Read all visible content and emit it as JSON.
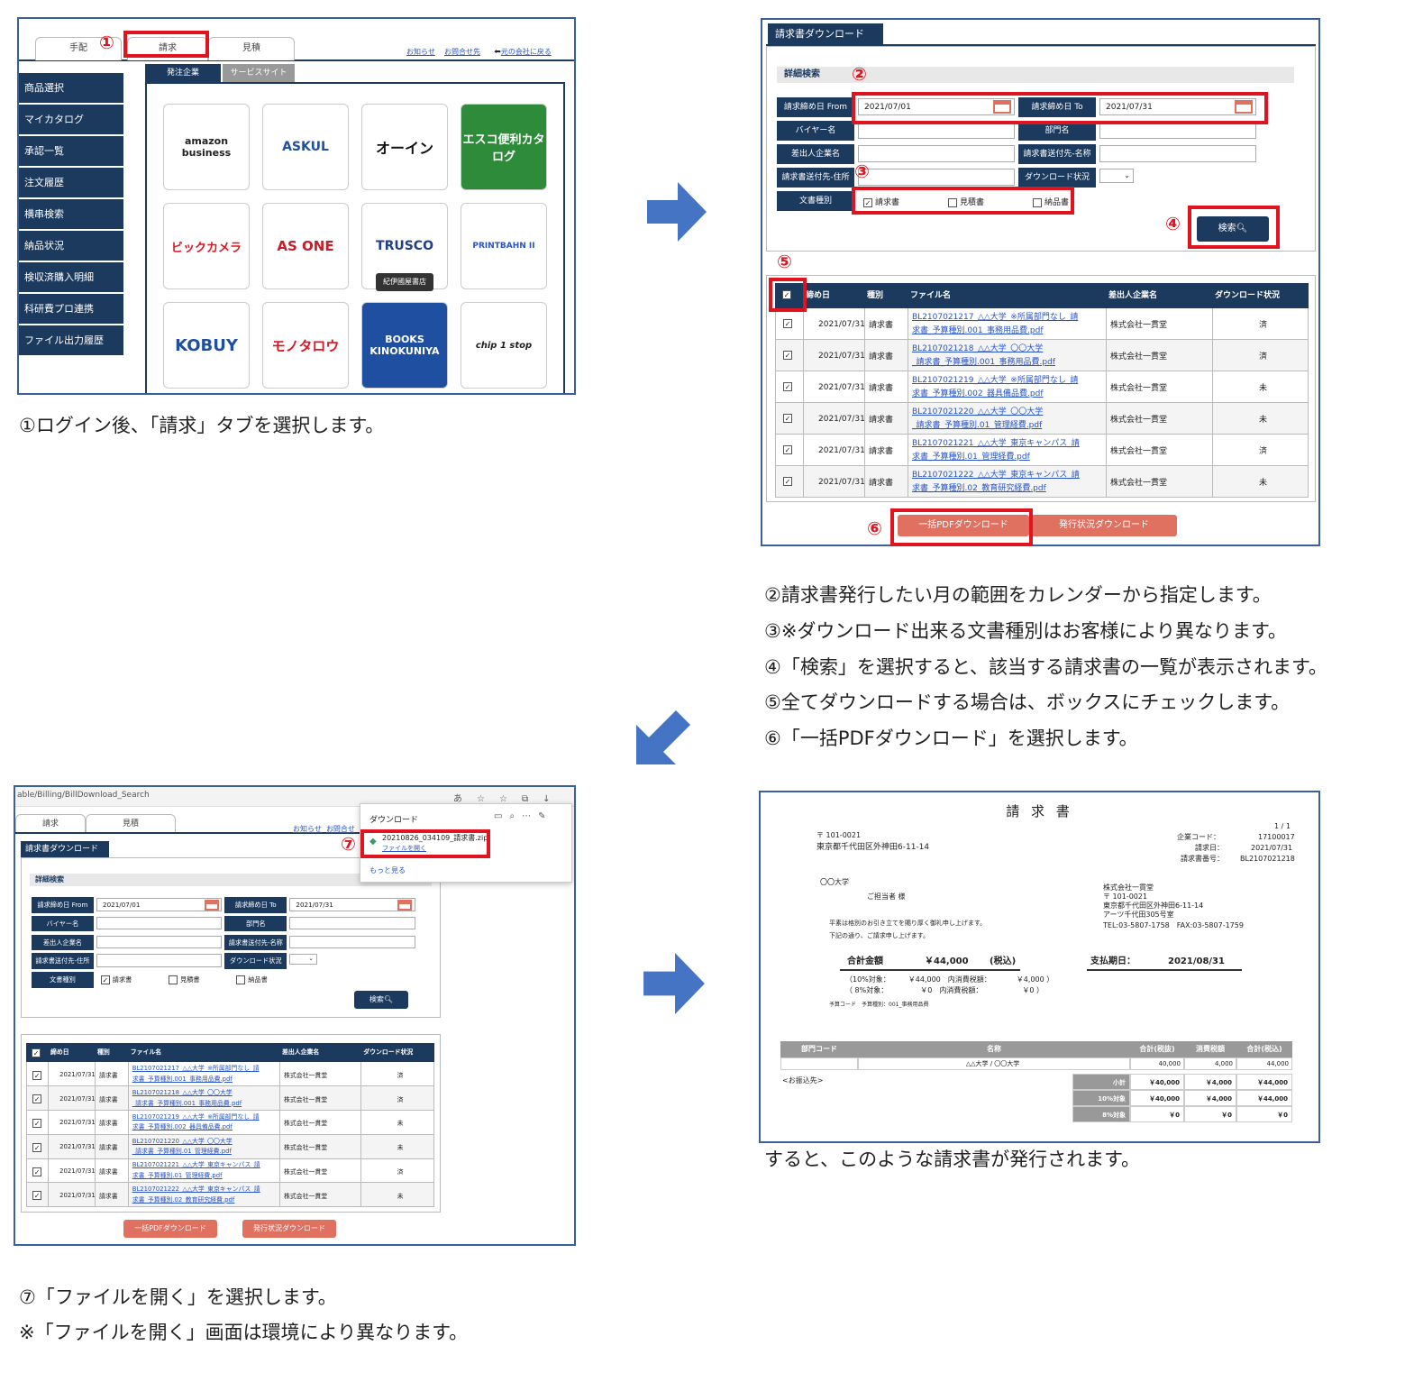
{
  "p1": {
    "tabs": [
      "手配",
      "請求",
      "見積"
    ],
    "links": [
      "お知らせ",
      "お問合せ先",
      "元の会社に戻る"
    ],
    "subtabs": [
      "発注企業",
      "サービスサイト"
    ],
    "sidebar": [
      "商品選択",
      "マイカタログ",
      "承認一覧",
      "注文履歴",
      "横串検索",
      "納品状況",
      "検収済購入明細",
      "科研費プロ連携",
      "ファイル出力履歴"
    ],
    "logos": [
      "amazon business",
      "ASKUL",
      "オーイン",
      "エスコ便利カタログ",
      "ビックカメラ",
      "AS ONE",
      "TRUSCO",
      "PRINTBAHN II",
      "KOBUY",
      "モノタロウ",
      "BOOKS KINOKUNIYA",
      "chip 1 stop"
    ],
    "tooltip": "紀伊國屋書店",
    "caption": "①ログイン後、「請求」タブを選択します。"
  },
  "p2": {
    "title": "請求書ダウンロード",
    "section": "詳細検索",
    "labels": [
      "請求締め日 From",
      "請求締め日 To",
      "バイヤー名",
      "部門名",
      "差出人企業名",
      "請求書送付先-名称",
      "請求書送付先-住所",
      "ダウンロード状況",
      "文書種別"
    ],
    "from": "2021/07/01",
    "to": "2021/07/31",
    "doc_types": [
      "請求書",
      "見積書",
      "納品書"
    ],
    "search_btn": "検索",
    "headers": [
      "締め日",
      "種別",
      "ファイル名",
      "差出人企業名",
      "ダウンロード状況"
    ],
    "rows": [
      {
        "date": "2021/07/31",
        "type": "請求書",
        "file1": "BL2107021217_△△大学_※所属部門なし_請",
        "file2": "求書_予算種別.001_事務用品費.pdf",
        "sender": "株式会社一貫堂",
        "status": "済"
      },
      {
        "date": "2021/07/31",
        "type": "請求書",
        "file1": "BL2107021218_△△大学_〇〇大学",
        "file2": "_請求書_予算種別.001_事務用品費.pdf",
        "sender": "株式会社一貫堂",
        "status": "済"
      },
      {
        "date": "2021/07/31",
        "type": "請求書",
        "file1": "BL2107021219_△△大学_※所属部門なし_請",
        "file2": "求書_予算種別.002_器具備品費.pdf",
        "sender": "株式会社一貫堂",
        "status": "未"
      },
      {
        "date": "2021/07/31",
        "type": "請求書",
        "file1": "BL2107021220_△△大学_〇〇大学",
        "file2": "_請求書_予算種別.01_管理経費.pdf",
        "sender": "株式会社一貫堂",
        "status": "未"
      },
      {
        "date": "2021/07/31",
        "type": "請求書",
        "file1": "BL2107021221_△△大学_東京キャンパス_請",
        "file2": "求書_予算種別.01_管理経費.pdf",
        "sender": "株式会社一貫堂",
        "status": "済"
      },
      {
        "date": "2021/07/31",
        "type": "請求書",
        "file1": "BL2107021222_△△大学_東京キャンパス_請",
        "file2": "求書_予算種別.02_教育研究経費.pdf",
        "sender": "株式会社一貫堂",
        "status": "未"
      }
    ],
    "btn_bulk": "一括PDFダウンロード",
    "btn_status": "発行状況ダウンロード",
    "captions": [
      "②請求書発行したい月の範囲をカレンダーから指定します。",
      "③※ダウンロード出来る文書種別はお客様により異なります。",
      "④「検索」を選択すると、該当する請求書の一覧が表示されます。",
      "⑤全てダウンロードする場合は、ボックスにチェックします。",
      "⑥「一括PDFダウンロード」を選択します。"
    ]
  },
  "p3": {
    "url": "able/Billing/BillDownload_Search",
    "addr_icons": [
      "あ",
      "☆",
      "☆",
      "⧉",
      "↓"
    ],
    "tabs": [
      "請求",
      "見積"
    ],
    "links": [
      "お知らせ",
      "お問合せ"
    ],
    "dl_title": "ダウンロード",
    "dl_file": "20210826_034109_請求書.zip",
    "dl_open": "ファイルを開く",
    "dl_more": "もっと見る",
    "captions": [
      "⑦「ファイルを開く」を選択します。",
      "※「ファイルを開く」画面は環境により異なります。"
    ]
  },
  "p4": {
    "title": "請 求 書",
    "page": "1 / 1",
    "zip": "〒 101-0021",
    "addr": "東京都千代田区外神田6-11-14",
    "company_code_l": "企業コード：",
    "company_code": "17100017",
    "date_l": "請求日：",
    "date": "2021/07/31",
    "no_l": "請求書番号：",
    "no": "BL2107021218",
    "to": "〇〇大学",
    "to_person": "ご担当者 様",
    "from_name": "株式会社一貫堂",
    "from_zip": "〒 101-0021",
    "from_addr": "東京都千代田区外神田6-11-14",
    "from_bldg": "アーツ千代田305号室",
    "from_tel": "TEL:03-5807-1758　FAX:03-5807-1759",
    "greet1": "平素は格別のお引き立てを賜り厚く御礼申し上げます。",
    "greet2": "下記の通り、ご請求申し上げます。",
    "total_l": "合計金額",
    "total": "￥44,000",
    "tax_in": "(税込)",
    "due_l": "支払期日：",
    "due": "2021/08/31",
    "t10": "（10%対象：　　　￥44,000　内消費税額：　　　　￥4,000 ）",
    "t8": "（ 8%対象：　　　　　￥0　内消費税額：　　　　　　￥0 ）",
    "budget": "予算コード　予算種別：001_事務用品費",
    "headers": [
      "部門コード",
      "名称",
      "合計(税抜)",
      "消費税額",
      "合計(税込)"
    ],
    "line": [
      "",
      "△△大学 / 〇〇大学",
      "40,000",
      "4,000",
      "44,000"
    ],
    "bank": "<お振込先>",
    "sums": [
      [
        "小計",
        "￥40,000",
        "￥4,000",
        "￥44,000"
      ],
      [
        "10%対象",
        "￥40,000",
        "￥4,000",
        "￥44,000"
      ],
      [
        "8%対象",
        "￥0",
        "￥0",
        "￥0"
      ]
    ],
    "caption": "すると、このような請求書が発行されます。"
  },
  "nums": [
    "①",
    "②",
    "③",
    "④",
    "⑤",
    "⑥",
    "⑦"
  ]
}
